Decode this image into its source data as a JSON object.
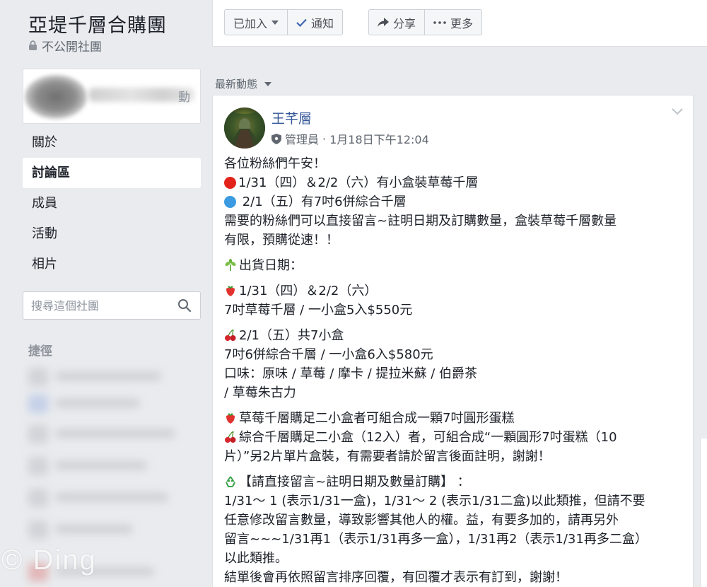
{
  "group": {
    "title": "亞堤千層合購團",
    "privacy": "不公開社團",
    "profile_tail": "動"
  },
  "nav": {
    "items": [
      {
        "label": "關於"
      },
      {
        "label": "討論區",
        "active": true
      },
      {
        "label": "成員"
      },
      {
        "label": "活動"
      },
      {
        "label": "相片"
      }
    ]
  },
  "search": {
    "placeholder": "搜尋這個社團"
  },
  "shortcuts": {
    "title": "捷徑"
  },
  "watermark": "© Ding",
  "topbar": {
    "joined_label": "已加入",
    "notify_label": "通知",
    "share_label": "分享",
    "more_label": "更多"
  },
  "feed": {
    "sort_label": "最新動態"
  },
  "post": {
    "author": "王芊層",
    "role": "管理員",
    "separator": "·",
    "timestamp": "1月18日下午12:04",
    "lines": {
      "greeting": "各位粉絲們午安！",
      "line_red": "1/31（四）＆2/2（六）有小盒裝草莓千層",
      "line_blue": " 2/1（五）有7吋6併綜合千層",
      "line_order_1": "需要的粉絲們可以直接留言~註明日期及訂購數量，盒裝草莓千層數量",
      "line_order_2": "有限，預購從速！！",
      "ship_title": "出貨日期：",
      "straw_date": "1/31（四）＆2/2（六）",
      "straw_item": "7吋草莓千層 / 一小盒5入$550元",
      "cherry_date": "2/1（五）共7小盒",
      "cherry_item": "7吋6併綜合千層 / 一小盒6入$580元",
      "flavor_1": "口味：原味 / 草莓 / 摩卡 / 提拉米蘇 / 伯爵茶",
      "flavor_2": "/ 草莓朱古力",
      "combo_1": "草莓千層購足二小盒者可組合成一顆7吋圓形蛋糕",
      "combo_2": "綜合千層購足二小盒（12入）者，可組合成“一顆圓形7吋蛋糕（10",
      "combo_3": "片）”另2片單片盒裝，有需要者請於留言後面註明，謝謝！",
      "rule_title": "【請直接留言~註明日期及數量訂購】 ：",
      "rule_1": "1/31～ 1 (表示1/31一盒)，1/31～ 2 (表示1/31二盒)以此類推，但請不要",
      "rule_2": "任意修改留言數量，導致影響其他人的權。益，有要多加的，請再另外",
      "rule_3": "留言~~~1/31再1（表示1/31再多一盒），1/31再2（表示1/31再多二盒）",
      "rule_4": "以此類推。",
      "closing": "結單後會再依照留言排序回覆，有回覆才表示有訂到，謝謝！"
    }
  },
  "colors": {
    "link": "#365899",
    "page_bg": "#e9ebee",
    "red_dot": "#e2231a",
    "blue_dot": "#3b9ae1"
  }
}
